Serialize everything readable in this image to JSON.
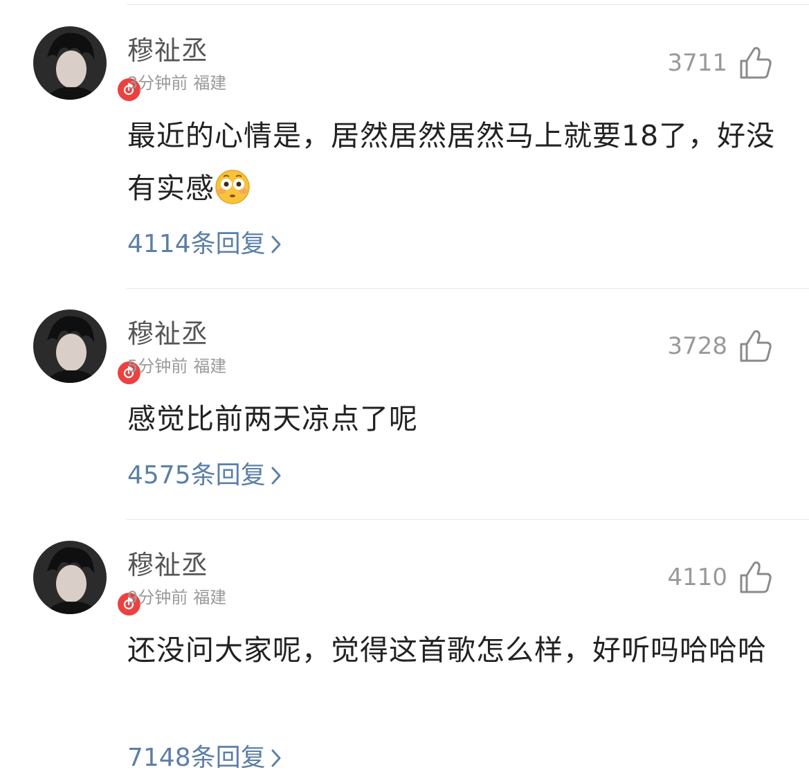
{
  "comments": [
    {
      "username": "穆祉丞",
      "time": "3分钟前",
      "location": "福建",
      "likes": "3711",
      "text": "最近的心情是，居然居然居然马上就要18了，好没有实感",
      "emoji": "flushed-face-emoji",
      "replies": "4114条回复"
    },
    {
      "username": "穆祉丞",
      "time": "5分钟前",
      "location": "福建",
      "likes": "3728",
      "text": "感觉比前两天凉点了呢",
      "replies": "4575条回复"
    },
    {
      "username": "穆祉丞",
      "time": "9分钟前",
      "location": "福建",
      "likes": "4110",
      "text": "还没问大家呢，觉得这首歌怎么样，好听吗哈哈哈",
      "replies": "7148条回复"
    }
  ],
  "icons": {
    "like": "thumbs-up-icon",
    "badge": "music-note-icon",
    "chevron": "chevron-right-icon"
  },
  "colors": {
    "badge_red": "#ec4141",
    "reply_link": "#5b7fa8",
    "text_primary": "#222222",
    "text_secondary": "#9a9a9a"
  }
}
